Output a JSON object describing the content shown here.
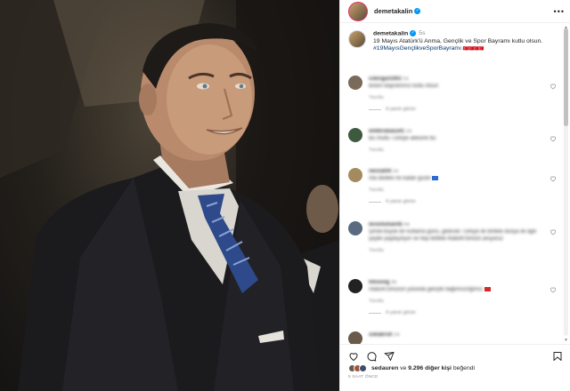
{
  "post": {
    "username": "demetakalin",
    "more_icon": "more-horizontal-icon",
    "image_alt": "Portrait photograph of a smiling man in a dark suit and striped tie"
  },
  "caption": {
    "username": "demetakalin",
    "time": "5s",
    "text": "19 Mayıs Atatürk'ü Anma, Gençlik ve Spor Bayramı kutlu olsun.",
    "hashtag": "#19MayısGençlikveSporBayramı",
    "emoji": "🇹🇷🇹🇷🇹🇷🇹🇷"
  },
  "comments": [
    {
      "user": "cokrigul1063",
      "time": "1s",
      "text": "Bütün Bayramınız kutlu olsun",
      "meta": "Yanıtla",
      "replies": "4 yanıtı görün"
    },
    {
      "user": "emlkrubasu41",
      "time": "1s",
      "text": "Bu mutlu Türkiye ailesine bu",
      "meta": "Yanıtla",
      "replies": ""
    },
    {
      "user": "nevzat44",
      "time": "1s",
      "text": "Ata dedeki ne kadar güzel",
      "meta": "Yanıtla",
      "replies": "4 yanıtı görün"
    },
    {
      "user": "lecestuhan45",
      "time": "5s",
      "text": "Şimdi büyük bir kutlama günü, gelecek Türkiye ile birlikte dünya ile ilgili şeyler paylaşılıyor ve hep birlikte Atatürk'ümüzü anıyoruz",
      "meta": "Yanıtla",
      "replies": "4 yanıtı görün"
    },
    {
      "user": "hmsong",
      "time": "3s",
      "text": "Atatürk'ümüzün yolunda gençlik bağımsızlığımız",
      "meta": "Yanıtla",
      "replies": "4 yanıtı görün"
    },
    {
      "user": "sokakruh",
      "time": "1s",
      "text": "",
      "meta": "",
      "replies": ""
    }
  ],
  "actions": {
    "like_icon": "heart-icon",
    "comment_icon": "comment-icon",
    "share_icon": "share-icon",
    "save_icon": "bookmark-icon"
  },
  "likes": {
    "first_user": "sedauren",
    "connector": "ve",
    "others": "9.296 diğer kişi",
    "suffix": "beğendi"
  },
  "timestamp": "5 SAAT ÖNCE",
  "colors": {
    "verified": "#0095f6",
    "link": "#00376b",
    "muted": "#8e8e8e",
    "story_ring": "#e1306c"
  }
}
